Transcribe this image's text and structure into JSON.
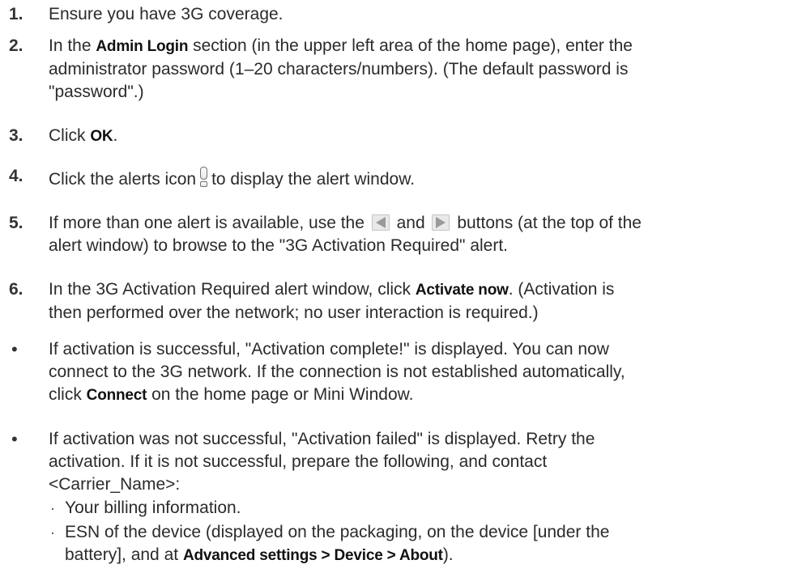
{
  "steps": [
    {
      "num": "1.",
      "text": "Ensure you have 3G coverage."
    },
    {
      "num": "2.",
      "pre": "In the ",
      "ui": "Admin Login",
      "line1_rest": " section (in the upper left area of the home page), enter the",
      "line2": "administrator password (1–20 characters/numbers). (The default password is",
      "line3": "\"password\".)"
    },
    {
      "num": "3.",
      "pre": "Click ",
      "ui": "OK",
      "post": "."
    },
    {
      "num": "4.",
      "pre": "Click the alerts icon",
      "post": "to display the alert window."
    },
    {
      "num": "5.",
      "pre": "If more than one alert is available, use the",
      "mid": "and",
      "post": "buttons (at the top of the",
      "line2": "alert window) to browse to the \"3G Activation Required\" alert."
    },
    {
      "num": "6.",
      "pre": "In the 3G Activation Required alert window, click ",
      "ui": "Activate now",
      "post": ". (Activation is",
      "line2": "then performed over the network; no user interaction is required.)"
    }
  ],
  "bullets": [
    {
      "mark": "•",
      "line1": "If activation is successful, \"Activation complete!\" is displayed. You can now",
      "line2": "connect to the 3G network. If the connection is not established automatically,",
      "line3_pre": "click ",
      "line3_ui": "Connect",
      "line3_post": " on the home page or Mini Window."
    },
    {
      "mark": "•",
      "line1": "If activation was not successful, \"Activation failed\" is displayed. Retry the",
      "line2": "activation. If it is not successful, prepare the following, and contact",
      "line3": "<Carrier_Name>:"
    }
  ],
  "subitems": [
    {
      "mark": "·",
      "text": "Your billing information."
    },
    {
      "mark": "·",
      "line1": "ESN of the device (displayed on the packaging, on the device [under the",
      "line2_pre": "battery], and at ",
      "line2_ui": "Advanced settings > Device > About",
      "line2_post": ")."
    }
  ],
  "icons": {
    "alert": "alerts-icon",
    "prev": "previous-arrow-icon",
    "next": "next-arrow-icon",
    "arrow_color": "#9a9a9a"
  }
}
